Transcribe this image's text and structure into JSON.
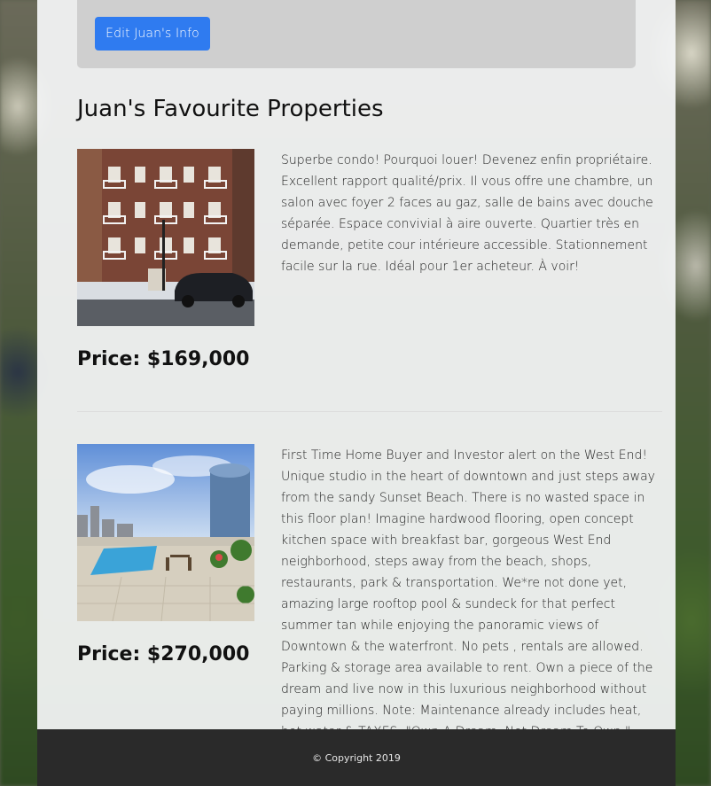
{
  "agent": {
    "edit_button_label": "Edit Juan's Info"
  },
  "favourites": {
    "title": "Juan's Favourite Properties",
    "properties": [
      {
        "image_icon": "condo-building-photo",
        "description": "Superbe condo! Pourquoi louer! Devenez enfin propriétaire. Excellent rapport qualité/prix. Il vous offre une chambre, un salon avec foyer 2 faces au gaz, salle de bains avec douche séparée. Espace convivial à aire ouverte. Quartier très en demande, petite cour intérieure accessible. Stationnement facile sur la rue. Idéal pour 1er acheteur. À voir!",
        "price": "Price: $169,000"
      },
      {
        "image_icon": "rooftop-pool-photo",
        "description": "First Time Home Buyer and Investor alert on the West End! Unique studio in the heart of downtown and just steps away from the sandy Sunset Beach. There is no wasted space in this floor plan! Imagine hardwood flooring, open concept kitchen space with breakfast bar, gorgeous West End neighborhood, steps away from the beach, shops, restaurants, park & transportation. We*re not done yet, amazing large rooftop pool & sundeck for that perfect summer tan while enjoying the panoramic views of Downtown & the waterfront. No pets , rentals are allowed. Parking & storage area available to rent. Own a piece of the dream and live now in this luxurious neighborhood without paying millions. Note: Maintenance already includes heat, hot water & TAXES. \"Own A Dream. Not Dream To Own.\"",
        "price": "Price: $270,000"
      }
    ]
  },
  "footer": {
    "copyright": "© Copyright 2019"
  }
}
